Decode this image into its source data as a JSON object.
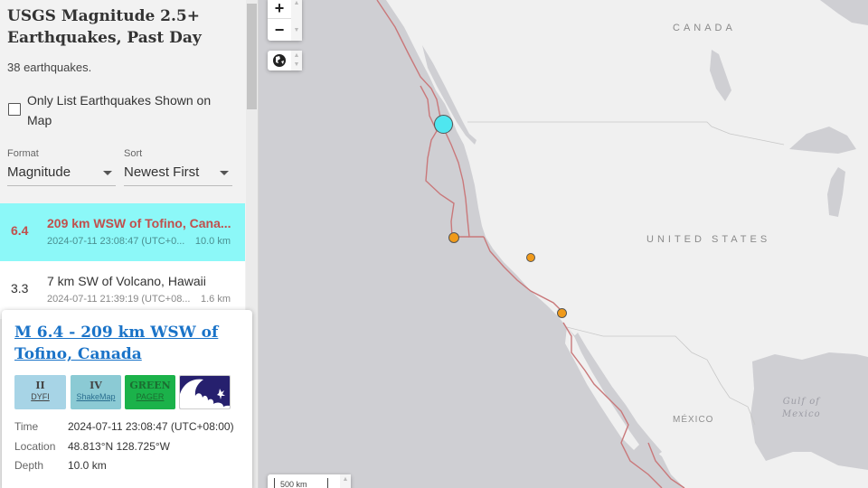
{
  "sidebar": {
    "title": "USGS Magnitude 2.5+ Earthquakes, Past Day",
    "count_text": "38 earthquakes.",
    "only_list_label": "Only List Earthquakes Shown on Map",
    "only_list_checked": false,
    "format": {
      "label": "Format",
      "value": "Magnitude"
    },
    "sort": {
      "label": "Sort",
      "value": "Newest First"
    },
    "earthquakes": [
      {
        "mag": "6.4",
        "place": "209 km WSW of Tofino, Cana...",
        "time": "2024-07-11 23:08:47 (UTC+0...",
        "depth": "10.0 km",
        "selected": true
      },
      {
        "mag": "3.3",
        "place": "7 km SW of Volcano, Hawaii",
        "time": "2024-07-11 21:39:19 (UTC+08...",
        "depth": "1.6 km",
        "selected": false
      }
    ]
  },
  "popup": {
    "title": "M 6.4 - 209 km WSW of Tofino, Canada",
    "badges": {
      "dyfi": {
        "value": "II",
        "label": "DYFI"
      },
      "shakemap": {
        "value": "IV",
        "label": "ShakeMap"
      },
      "pager": {
        "value": "GREEN",
        "label": "PAGER"
      },
      "tsunami": {
        "icon": "tsunami-wave-icon"
      }
    },
    "details": [
      {
        "label": "Time",
        "value": "2024-07-11 23:08:47 (UTC+08:00)"
      },
      {
        "label": "Location",
        "value": "48.813°N 128.725°W"
      },
      {
        "label": "Depth",
        "value": "10.0 km"
      }
    ]
  },
  "map": {
    "controls": {
      "zoom_in": "+",
      "zoom_out": "−",
      "scale": "500 km"
    },
    "labels": {
      "canada": "CANADA",
      "united_states": "UNITED STATES",
      "mexico": "MÉXICO",
      "gulf": "Gulf of Mexico",
      "gulf_line1": "Gulf of",
      "gulf_line2": "Mexico"
    },
    "colors": {
      "ocean": "#cfcfd3",
      "land": "#f0f0f0",
      "plate_boundary": "#c9787a",
      "selected_quake": "#4fe6ef",
      "quake": "#f09a1a"
    },
    "earthquakes": [
      {
        "id": "tofino",
        "mag": 6.4,
        "selected": true
      },
      {
        "id": "nor-cal-offshore",
        "selected": false
      },
      {
        "id": "nevada",
        "selected": false
      },
      {
        "id": "so-cal",
        "selected": false
      }
    ]
  }
}
